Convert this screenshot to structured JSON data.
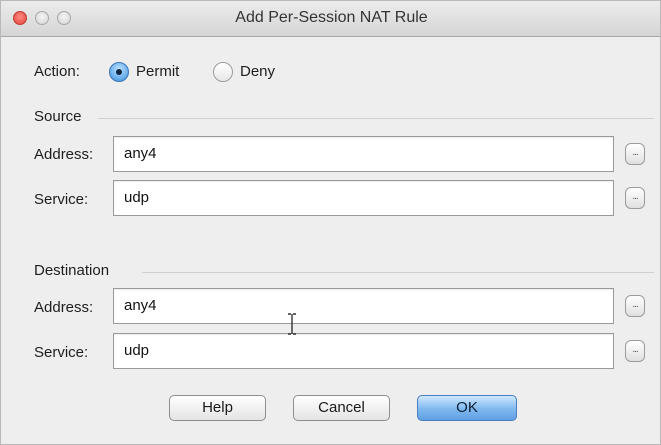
{
  "window": {
    "title": "Add Per-Session NAT Rule"
  },
  "action": {
    "label": "Action:",
    "options": [
      {
        "label": "Permit",
        "selected": true
      },
      {
        "label": "Deny",
        "selected": false
      }
    ]
  },
  "source": {
    "title": "Source",
    "address_label": "Address:",
    "address_value": "any4",
    "service_label": "Service:",
    "service_value": "udp"
  },
  "destination": {
    "title": "Destination",
    "address_label": "Address:",
    "address_value": "any4",
    "service_label": "Service:",
    "service_value": "udp"
  },
  "browse_button_label": "...",
  "buttons": {
    "help": "Help",
    "cancel": "Cancel",
    "ok": "OK"
  }
}
